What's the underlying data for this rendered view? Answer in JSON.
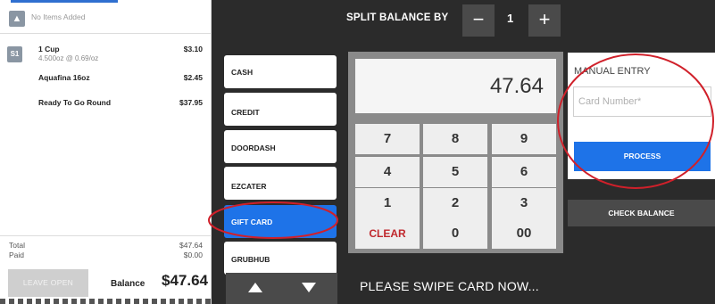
{
  "ticket": {
    "header_icon": "shirt-icon",
    "empty_label": "No Items Added",
    "seat_badge": "S1",
    "items": [
      {
        "name": "1 Cup",
        "detail": "4.500oz @ 0.69/oz",
        "price": "$3.10"
      },
      {
        "name": "Aquafina 16oz",
        "detail": "",
        "price": "$2.45"
      },
      {
        "name": "Ready To Go Round",
        "detail": "",
        "price": "$37.95"
      }
    ],
    "total_label": "Total",
    "total_value": "$47.64",
    "paid_label": "Paid",
    "paid_value": "$0.00",
    "leave_open_label": "LEAVE OPEN",
    "balance_label": "Balance",
    "balance_value": "$47.64"
  },
  "split": {
    "label": "SPLIT BALANCE BY",
    "minus": "−",
    "count": "1",
    "plus": "+"
  },
  "tenders": [
    {
      "label": "CASH",
      "active": false
    },
    {
      "label": "CREDIT",
      "active": false
    },
    {
      "label": "DOORDASH",
      "active": false
    },
    {
      "label": "EZCATER",
      "active": false
    },
    {
      "label": "GIFT CARD",
      "active": true
    },
    {
      "label": "GRUBHUB",
      "active": false
    }
  ],
  "tender_scroll": {
    "up_icon": "triangle-up-icon",
    "down_icon": "triangle-down-icon"
  },
  "keypad": {
    "amount": "47.64",
    "keys": [
      "7",
      "8",
      "9",
      "4",
      "5",
      "6",
      "1",
      "2",
      "3",
      "CLEAR",
      "0",
      "00"
    ]
  },
  "swipe_prompt": "PLEASE SWIPE CARD NOW...",
  "manual_entry": {
    "title": "MANUAL ENTRY",
    "card_placeholder": "Card Number*",
    "card_value": "",
    "process_label": "PROCESS"
  },
  "check_balance_label": "CHECK BALANCE",
  "colors": {
    "accent": "#1e73e8",
    "clear": "#c0282d",
    "annotation": "#d0202a",
    "dark_bg": "#2b2b2b"
  }
}
